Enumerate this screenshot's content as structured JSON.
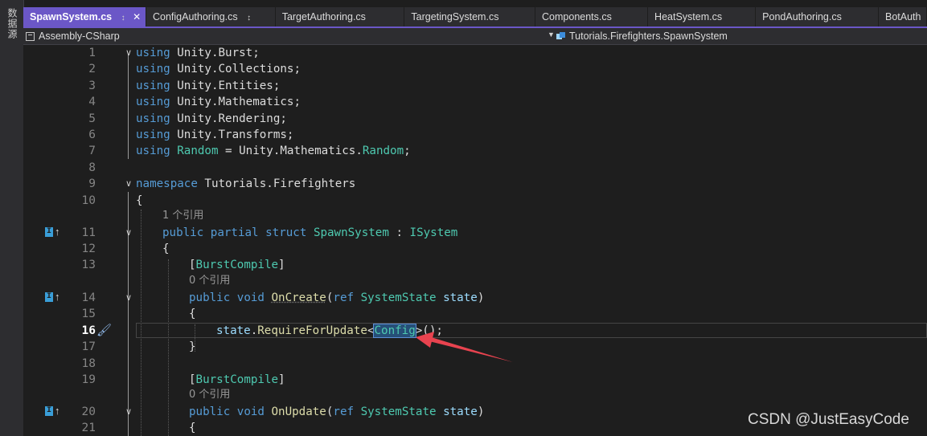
{
  "side_panel": {
    "label": "数据源"
  },
  "tabs": [
    {
      "label": "SpawnSystem.cs",
      "active": true,
      "pin": "↕",
      "close": "✕"
    },
    {
      "label": "ConfigAuthoring.cs",
      "pin": "↕"
    },
    {
      "label": "TargetAuthoring.cs"
    },
    {
      "label": "TargetingSystem.cs"
    },
    {
      "label": "Components.cs"
    },
    {
      "label": "HeatSystem.cs"
    },
    {
      "label": "PondAuthoring.cs"
    },
    {
      "label": "BotAuth"
    }
  ],
  "navbar": {
    "project": "Assembly-CSharp",
    "member": "Tutorials.Firefighters.SpawnSystem"
  },
  "code": {
    "l1": {
      "n": "1",
      "kw": "using",
      "rest": " Unity.Burst;"
    },
    "l2": {
      "n": "2",
      "kw": "using",
      "rest": " Unity.Collections;"
    },
    "l3": {
      "n": "3",
      "kw": "using",
      "rest": " Unity.Entities;"
    },
    "l4": {
      "n": "4",
      "kw": "using",
      "rest": " Unity.Mathematics;"
    },
    "l5": {
      "n": "5",
      "kw": "using",
      "rest": " Unity.Rendering;"
    },
    "l6": {
      "n": "6",
      "kw": "using",
      "rest": " Unity.Transforms;"
    },
    "l7": {
      "n": "7",
      "kw": "using",
      "alias": "Random",
      "mid": " = Unity.Mathematics.",
      "ty": "Random",
      "end": ";"
    },
    "l8": {
      "n": "8"
    },
    "l9": {
      "n": "9",
      "kw": "namespace",
      "rest": " Tutorials.Firefighters"
    },
    "l10": {
      "n": "10",
      "rest": "{"
    },
    "ref1": "1 个引用",
    "l11": {
      "n": "11",
      "kw1": "public",
      "kw2": "partial",
      "kw3": "struct",
      "ty": "SpawnSystem",
      "mid": " : ",
      "iface": "ISystem"
    },
    "l12": {
      "n": "12",
      "rest": "{"
    },
    "l13": {
      "n": "13",
      "open": "[",
      "attr": "BurstCompile",
      "close": "]"
    },
    "ref2": "0 个引用",
    "l14": {
      "n": "14",
      "kw1": "public",
      "kw2": "void",
      "fn": "OnCreate",
      "p1": "(",
      "kw3": "ref",
      "ty": "SystemState",
      "pm": "state",
      "p2": ")"
    },
    "l15": {
      "n": "15",
      "rest": "{"
    },
    "l16": {
      "n": "16",
      "pm": "state",
      "dot": ".",
      "fn": "RequireForUpdate",
      "lt": "<",
      "ty": "Config",
      "gt": ">",
      "end": "();"
    },
    "l17": {
      "n": "17",
      "rest": "}"
    },
    "l18": {
      "n": "18"
    },
    "l19": {
      "n": "19",
      "open": "[",
      "attr": "BurstCompile",
      "close": "]"
    },
    "ref3": "0 个引用",
    "l20": {
      "n": "20",
      "kw1": "public",
      "kw2": "void",
      "fn": "OnUpdate",
      "p1": "(",
      "kw3": "ref",
      "ty": "SystemState",
      "pm": "state",
      "p2": ")"
    },
    "l21": {
      "n": "21",
      "rest": "{"
    }
  },
  "gutter": {
    "implement_badge": "I",
    "implement_arrow": "↑",
    "fold_glyph": "∨"
  },
  "watermark": "CSDN @JustEasyCode",
  "colors": {
    "accent": "#6b57c7",
    "keyword": "#569cd6",
    "type": "#4ec9b0",
    "method": "#dcdcaa",
    "param": "#9cdcfe",
    "annotation_arrow": "#e8434f"
  }
}
